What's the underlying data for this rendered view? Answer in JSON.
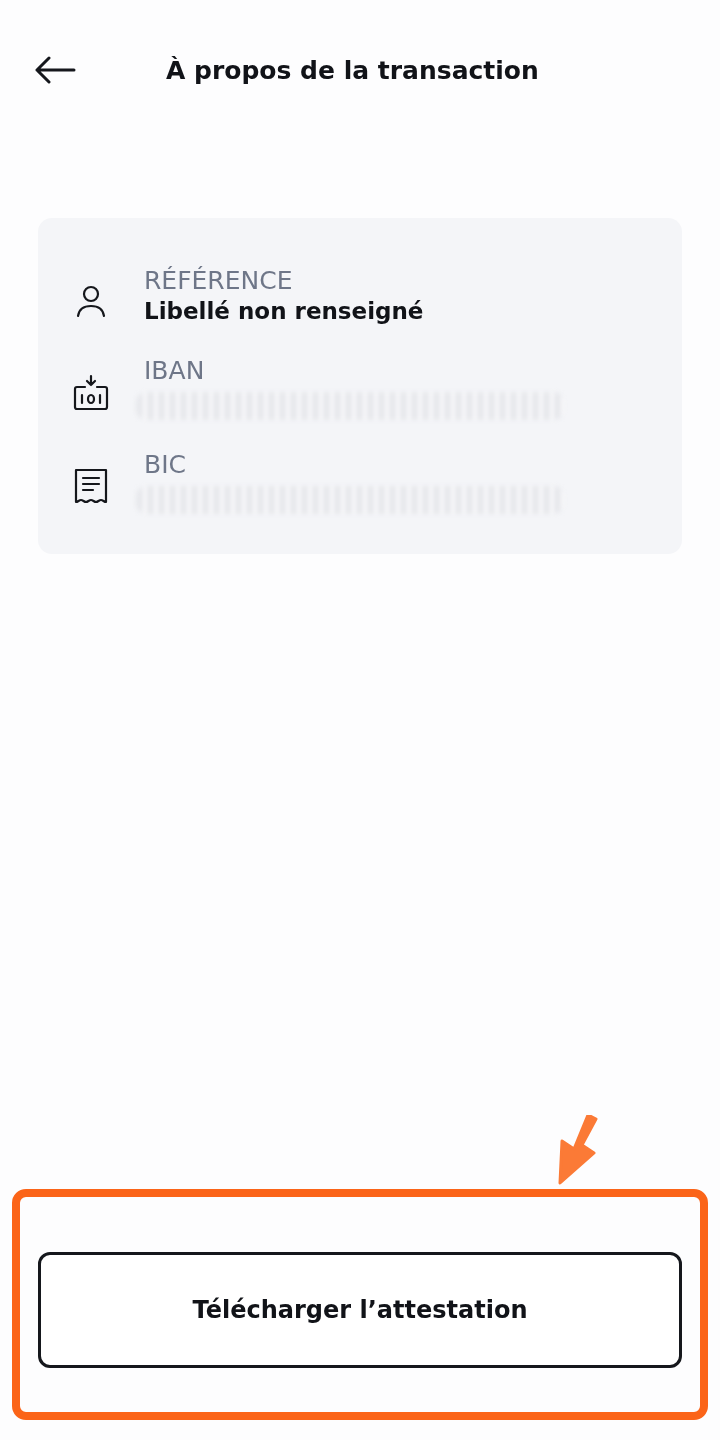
{
  "header": {
    "title": "À propos de la transaction"
  },
  "details": [
    {
      "kind": "text",
      "label": "RÉFÉRENCE",
      "value": "Libellé non renseigné"
    },
    {
      "kind": "redacted",
      "label": "IBAN"
    },
    {
      "kind": "redacted",
      "label": "BIC"
    }
  ],
  "button": {
    "label": "Télécharger l’attestation",
    "highlighted": true
  }
}
